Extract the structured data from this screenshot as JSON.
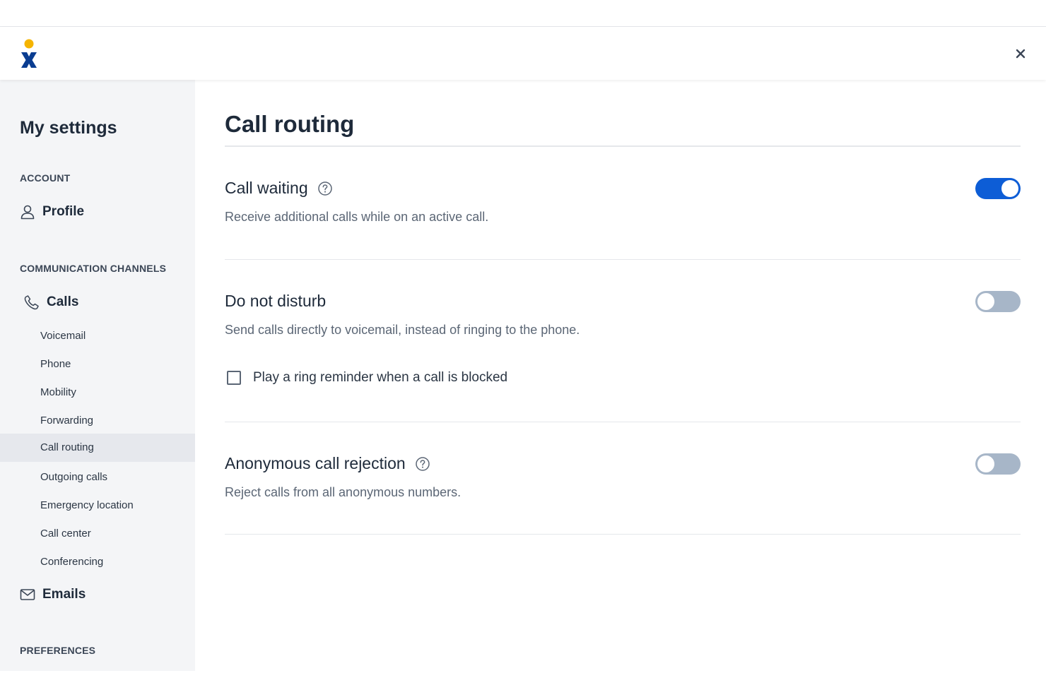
{
  "header": {
    "close_label": "Close"
  },
  "sidebar": {
    "title": "My settings",
    "sections": {
      "account": "ACCOUNT",
      "communication": "COMMUNICATION CHANNELS",
      "preferences": "PREFERENCES"
    },
    "profile_label": "Profile",
    "calls_label": "Calls",
    "emails_label": "Emails",
    "call_items": [
      "Voicemail",
      "Phone",
      "Mobility",
      "Forwarding",
      "Call routing",
      "Outgoing calls",
      "Emergency location",
      "Call center",
      "Conferencing"
    ],
    "active_item": "Call routing"
  },
  "main": {
    "title": "Call routing",
    "settings": [
      {
        "title": "Call waiting",
        "description": "Receive additional calls while on an active call.",
        "enabled": true,
        "has_help": true
      },
      {
        "title": "Do not disturb",
        "description": "Send calls directly to voicemail, instead of ringing to the phone.",
        "enabled": false,
        "has_help": false,
        "checkbox": {
          "label": "Play a ring reminder when a call is blocked",
          "checked": false
        }
      },
      {
        "title": "Anonymous call rejection",
        "description": "Reject calls from all anonymous numbers.",
        "enabled": false,
        "has_help": true
      }
    ]
  },
  "colors": {
    "accent": "#0d5dd6",
    "toggle_off": "#a7b6c8",
    "logo_yellow": "#f5b400",
    "logo_blue": "#0a3d91",
    "sidebar_bg": "#f4f5f7",
    "active_bg": "#e6e8ed"
  }
}
